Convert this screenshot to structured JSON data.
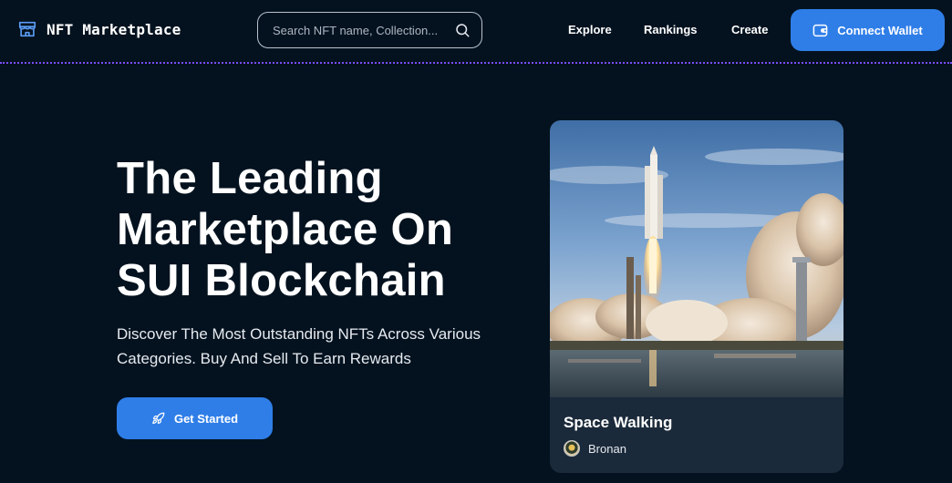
{
  "header": {
    "logo_text": "NFT Marketplace",
    "search": {
      "placeholder": "Search NFT name, Collection..."
    },
    "nav": [
      {
        "label": "Explore"
      },
      {
        "label": "Rankings"
      },
      {
        "label": "Create"
      }
    ],
    "connect_wallet_label": "Connect Wallet"
  },
  "hero": {
    "title": "The Leading Marketplace On SUI Blockchain",
    "subtitle": "Discover The Most Outstanding NFTs Across Various Categories. Buy And Sell To Earn Rewards",
    "cta_label": "Get Started"
  },
  "featured_nft": {
    "title": "Space Walking",
    "creator": "Bronan"
  },
  "icons": {
    "logo": "storefront-icon",
    "search": "search-icon",
    "wallet": "wallet-icon",
    "cta": "rocket-icon"
  },
  "colors": {
    "background": "#04121f",
    "accent": "#2f7ee8",
    "divider": "#7b4cff",
    "card": "#1b2a3a"
  }
}
